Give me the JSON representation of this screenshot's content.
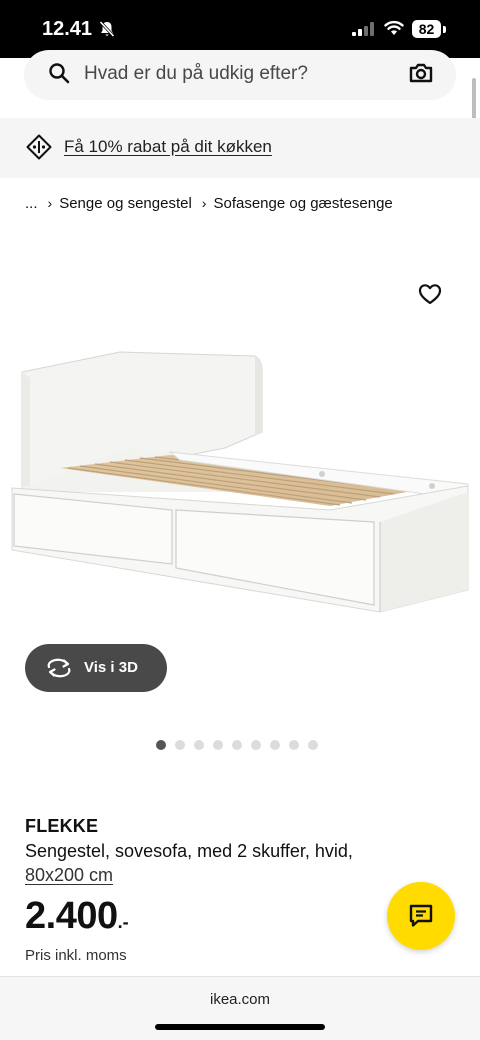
{
  "status_bar": {
    "time": "12.41",
    "battery": "82"
  },
  "search": {
    "placeholder": "Hvad er du på udkig efter?"
  },
  "promo": {
    "text": "Få 10% rabat på dit køkken"
  },
  "breadcrumb": {
    "items": [
      "...",
      "Senge og sengestel",
      "Sofasenge og gæstesenge"
    ],
    "separator": "›"
  },
  "gallery": {
    "view3d_label": "Vis i 3D",
    "image_count": 9,
    "active_index": 0
  },
  "product": {
    "name": "FLEKKE",
    "description": "Sengestel, sovesofa, med 2 skuffer, hvid,",
    "size": "80x200 cm",
    "price_main": "2.400",
    "price_suffix": ".-",
    "price_note": "Pris inkl. moms"
  },
  "browser": {
    "domain": "ikea.com"
  },
  "colors": {
    "chat_button": "#ffdb00",
    "view3d_button": "#494949"
  }
}
